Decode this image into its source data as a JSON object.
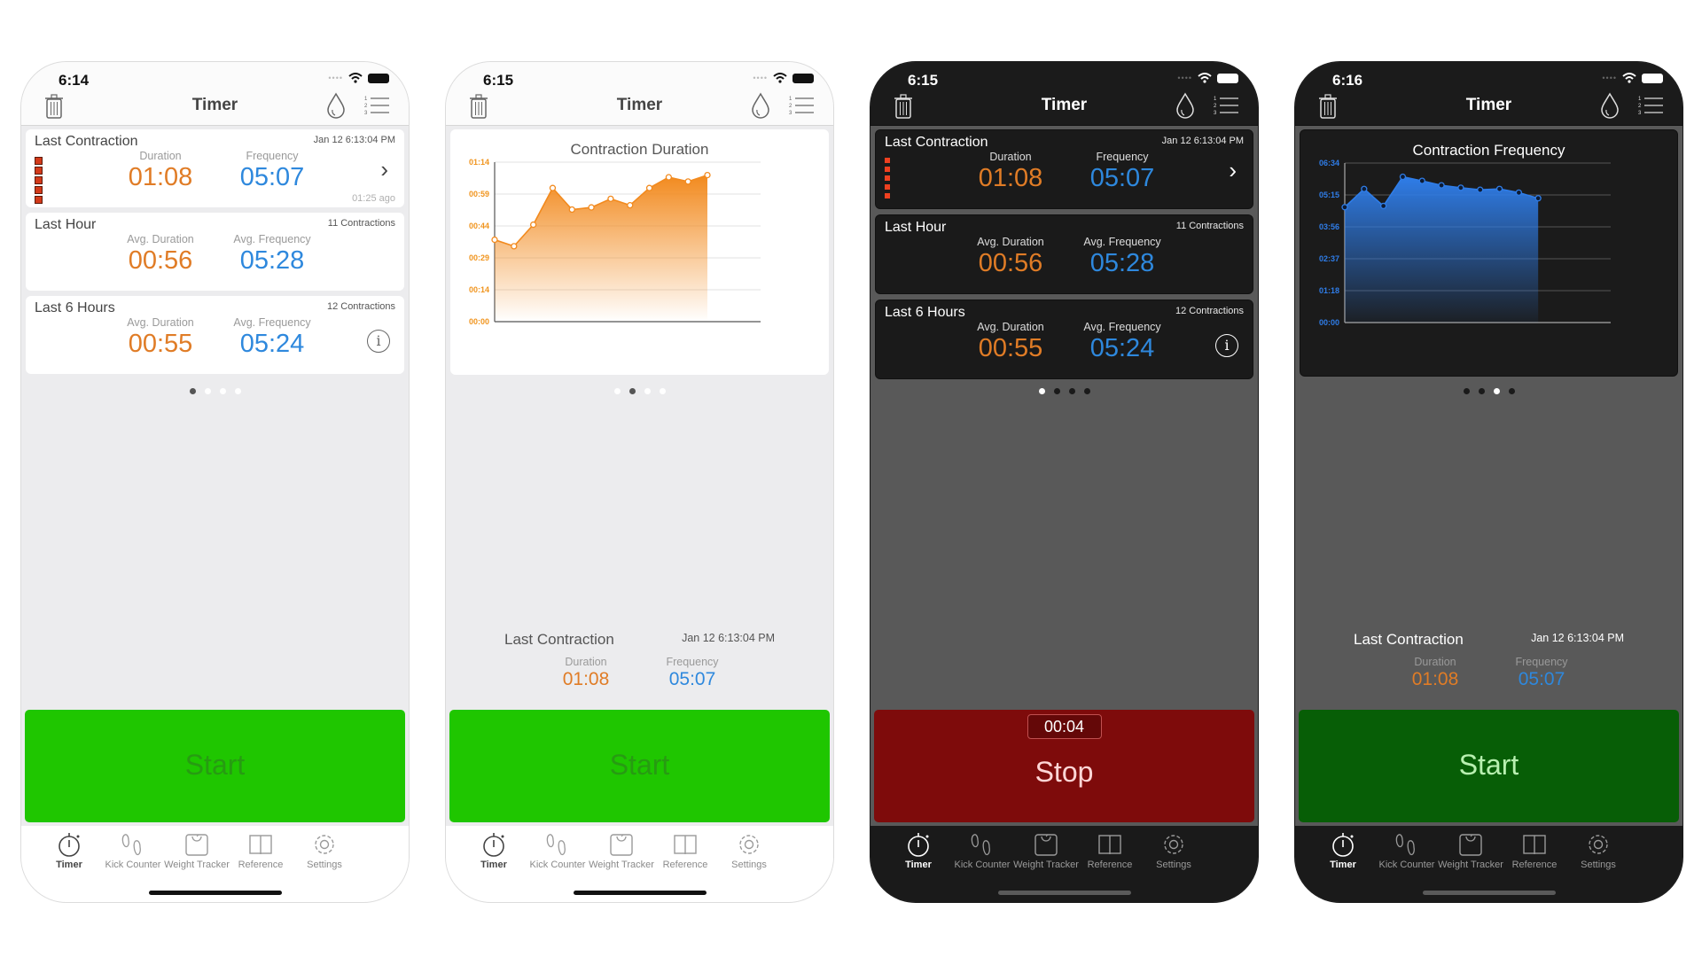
{
  "colors": {
    "duration_orange": "#e07c26",
    "frequency_blue": "#2e88dd",
    "start_green": "#1fc600",
    "start_green_dark": "#075e06",
    "stop_red": "#7e0b0b"
  },
  "common": {
    "app_title": "Timer",
    "last_contraction": "Last Contraction",
    "last_contraction_date": "Jan 12 6:13:04 PM",
    "duration_label": "Duration",
    "frequency_label": "Frequency",
    "last_duration": "01:08",
    "last_frequency": "05:07",
    "ago": "01:25 ago",
    "last_hour": "Last Hour",
    "last_hour_count": "11 Contractions",
    "avg_duration_label": "Avg. Duration",
    "avg_frequency_label": "Avg. Frequency",
    "hour_avg_duration": "00:56",
    "hour_avg_frequency": "05:28",
    "last_6_hours": "Last 6 Hours",
    "six_count": "12 Contractions",
    "six_avg_duration": "00:55",
    "six_avg_frequency": "05:24",
    "start_label": "Start",
    "stop_label": "Stop",
    "running_timer": "00:04",
    "chevron": "›",
    "info": "i",
    "icons": {
      "trash": "trash-icon",
      "drop": "water-drop-icon",
      "list": "numbered-list-icon",
      "chevron": "chevron-right-icon",
      "info": "info-icon"
    },
    "tabs": [
      {
        "label": "Timer",
        "icon": "stopwatch-icon"
      },
      {
        "label": "Kick Counter",
        "icon": "footprints-icon"
      },
      {
        "label": "Weight Tracker",
        "icon": "scale-icon"
      },
      {
        "label": "Reference",
        "icon": "book-icon"
      },
      {
        "label": "Settings",
        "icon": "gear-icon"
      }
    ]
  },
  "phones": [
    {
      "time": "6:14",
      "theme": "light",
      "page_index": 0,
      "page_count": 4
    },
    {
      "time": "6:15",
      "theme": "light",
      "page_index": 1,
      "page_count": 4
    },
    {
      "time": "6:15",
      "theme": "dark",
      "page_index": 0,
      "page_count": 4
    },
    {
      "time": "6:16",
      "theme": "dark",
      "page_index": 2,
      "page_count": 4
    }
  ],
  "chart_data": [
    {
      "type": "area",
      "title": "Contraction Duration",
      "xlabel": "",
      "ylabel": "",
      "unit": "seconds",
      "ytick_labels": [
        "00:00",
        "00:14",
        "00:29",
        "00:44",
        "00:59",
        "01:14"
      ],
      "ylim": [
        0,
        74
      ],
      "grid": true,
      "x": [
        1,
        2,
        3,
        4,
        5,
        6,
        7,
        8,
        9,
        10,
        11,
        12
      ],
      "values": [
        38,
        35,
        45,
        62,
        52,
        53,
        57,
        54,
        62,
        67,
        65,
        68
      ],
      "color": "#f28a1e"
    },
    {
      "type": "area",
      "title": "Contraction Frequency",
      "xlabel": "",
      "ylabel": "",
      "unit": "seconds",
      "ytick_labels": [
        "00:00",
        "01:18",
        "02:37",
        "03:56",
        "05:15",
        "06:34"
      ],
      "ylim": [
        0,
        394
      ],
      "grid": true,
      "x": [
        1,
        2,
        3,
        4,
        5,
        6,
        7,
        8,
        9,
        10,
        11
      ],
      "values": [
        285,
        330,
        288,
        360,
        350,
        339,
        333,
        328,
        330,
        321,
        307
      ],
      "color": "#2f7de8"
    }
  ]
}
